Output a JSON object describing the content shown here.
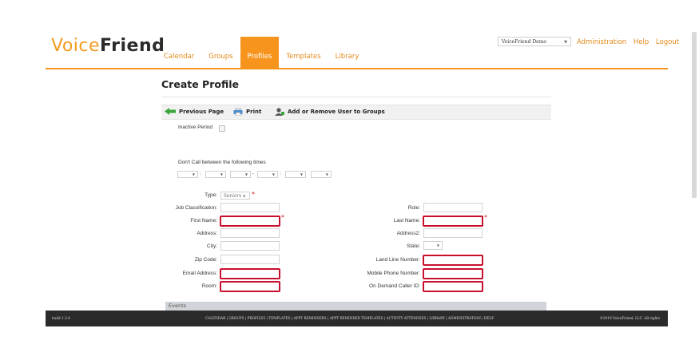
{
  "brand": {
    "part1": "Voice",
    "part2": "Friend"
  },
  "nav": [
    "Calendar",
    "Groups",
    "Profiles",
    "Templates",
    "Library"
  ],
  "org_select": "VoiceFriend Demo",
  "toplinks": [
    "Administration",
    "Help",
    "Logout"
  ],
  "page_title": "Create Profile",
  "toolbar": {
    "previous": "Previous Page",
    "print": "Print",
    "groups": "Add or Remove User to Groups"
  },
  "inactive_label": "Inactive Period",
  "dont_call_label": "Don't Call between the following times",
  "time_separators": [
    ":",
    "-",
    ":"
  ],
  "type_label": "Type:",
  "type_value": "Seniors",
  "fields_left": [
    "Job Classification:",
    "First Name:",
    "Address:",
    "City:",
    "Zip Code:",
    "Email Address:",
    "Room:"
  ],
  "fields_right": [
    "Role:",
    "Last Name:",
    "Address2:",
    "State:",
    "Land Line Number:",
    "Mobile Phone Number:",
    "On Demand Caller ID:"
  ],
  "required_star": "*",
  "events_label": "Events",
  "footer": {
    "build": "build 1.3.4",
    "links": "CALENDAR | GROUPS | PROFILES | TEMPLATES | APPT REMINDERS | APPT REMINDER TEMPLATES | ACTIVITY ATTENDEES | LIBRARY | ADMINISTRATION | HELP",
    "copyright": "©2019 VoiceFriend, LLC. All rights"
  },
  "colors": {
    "accent": "#f7941d",
    "required_border": "#c8102e",
    "footer_bg": "#2b2b2b"
  }
}
